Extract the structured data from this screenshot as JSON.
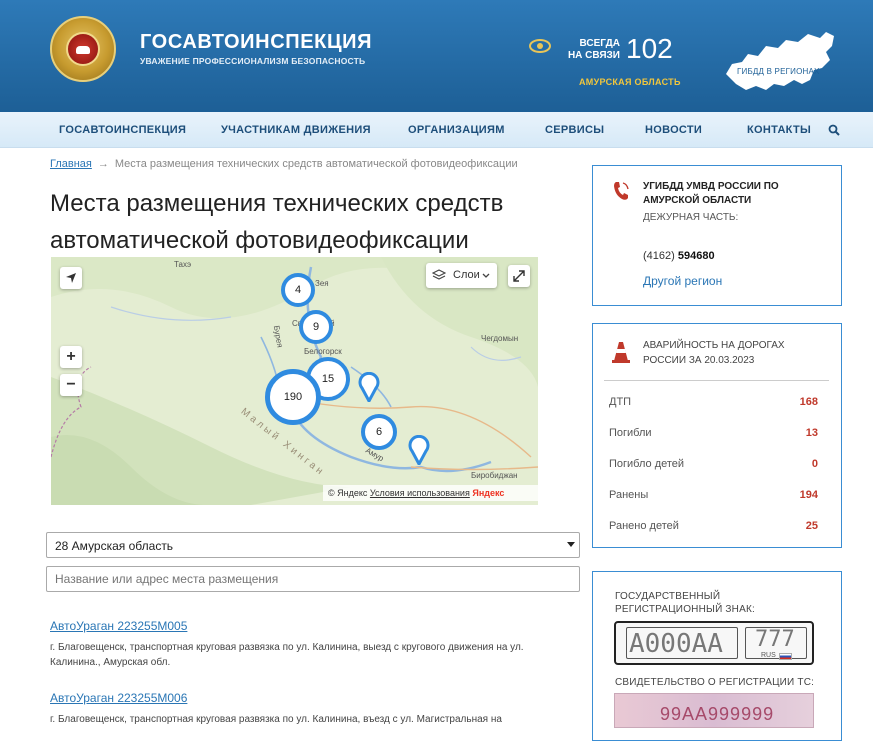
{
  "header": {
    "brand_title": "ГОСАВТОИНСПЕКЦИЯ",
    "brand_subtitle": "УВАЖЕНИЕ ПРОФЕССИОНАЛИЗМ БЕЗОПАСНОСТЬ",
    "hotline_line1": "ВСЕГДА",
    "hotline_line2": "НА СВЯЗИ",
    "hotline_number": "102",
    "region": "АМУРСКАЯ ОБЛАСТЬ",
    "regions_map_label": "ГИБДД В РЕГИОНАХ",
    "brand_color": "#1d5f96",
    "accent_color": "#f1c63d"
  },
  "nav": {
    "items": [
      "ГОСАВТОИНСПЕКЦИЯ",
      "УЧАСТНИКАМ ДВИЖЕНИЯ",
      "ОРГАНИЗАЦИЯМ",
      "СЕРВИСЫ",
      "НОВОСТИ",
      "КОНТАКТЫ"
    ],
    "search_icon": "search-icon"
  },
  "breadcrumb": {
    "home": "Главная",
    "arrow": "→",
    "current": "Места размещения технических средств автоматической фотовидеофиксации"
  },
  "page_title_line1": "Места размещения технических средств",
  "page_title_line2": "автоматической фотовидеофиксации",
  "map": {
    "layers_label": "Слои",
    "clusters": [
      "4",
      "9",
      "15",
      "190",
      "6"
    ],
    "labels": [
      "Тахэ",
      "Зея",
      "Свободный",
      "Белогорск",
      "Чегдомын",
      "Биробиджан",
      "Амур",
      "Бурея",
      "Малый Хинган"
    ],
    "copyright": "© Яндекс",
    "terms": "Условия использования",
    "provider": "Яндекс"
  },
  "filters": {
    "region_selected": "28 Амурская область",
    "search_placeholder": "Название или адрес места размещения"
  },
  "results": [
    {
      "title": "АвтоУраган 223255М005",
      "address": "г. Благовещенск, транспортная круговая развязка по ул. Калинина, выезд с кругового движения на ул. Калинина., Амурская обл."
    },
    {
      "title": "АвтоУраган 223255М006",
      "address": "г. Благовещенск, транспортная круговая развязка по ул. Калинина, въезд с ул. Магистральная на"
    }
  ],
  "contact": {
    "department": "УГИБДД УМВД РОССИИ ПО АМУРСКОЙ ОБЛАСТИ",
    "duty_label": "ДЕЖУРНАЯ ЧАСТЬ:",
    "phone_code": "(4162)",
    "phone_number": "594680",
    "other_region": "Другой регион"
  },
  "accidents": {
    "title": "АВАРИЙНОСТЬ НА ДОРОГАХ РОССИИ ЗА 20.03.2023",
    "stats": [
      {
        "label": "ДТП",
        "value": "168"
      },
      {
        "label": "Погибли",
        "value": "13"
      },
      {
        "label": "Погибло детей",
        "value": "0"
      },
      {
        "label": "Ранены",
        "value": "194"
      },
      {
        "label": "Ранено детей",
        "value": "25"
      }
    ],
    "value_color": "#c0392b"
  },
  "check": {
    "plate_heading": "ГОСУДАРСТВЕННЫЙ РЕГИСТРАЦИОННЫЙ ЗНАК:",
    "plate_number": "А000АА",
    "plate_region": "777",
    "plate_country": "RUS",
    "cert_heading": "СВИДЕТЕЛЬСТВО О РЕГИСТРАЦИИ ТС:",
    "cert_number": "99АА999999"
  }
}
